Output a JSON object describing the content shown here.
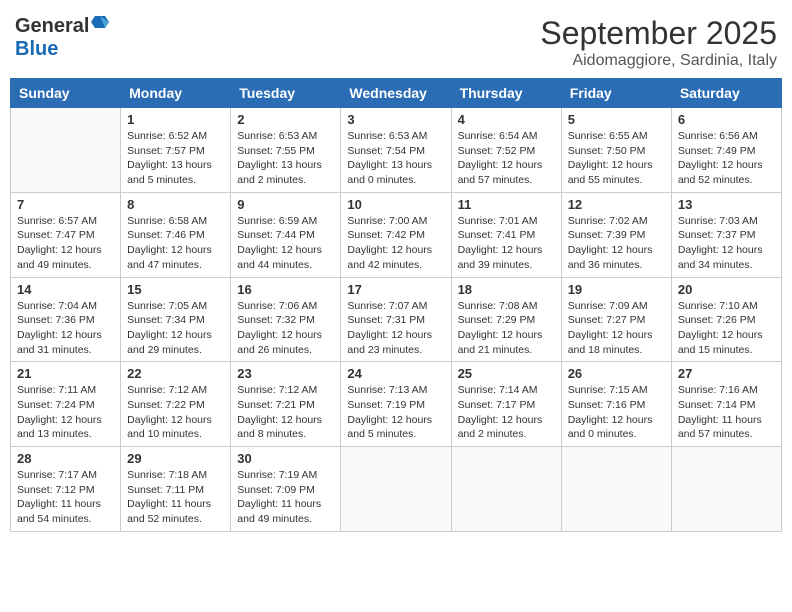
{
  "header": {
    "logo_general": "General",
    "logo_blue": "Blue",
    "title": "September 2025",
    "location": "Aidomaggiore, Sardinia, Italy"
  },
  "columns": [
    "Sunday",
    "Monday",
    "Tuesday",
    "Wednesday",
    "Thursday",
    "Friday",
    "Saturday"
  ],
  "weeks": [
    [
      {
        "day": "",
        "info": ""
      },
      {
        "day": "1",
        "info": "Sunrise: 6:52 AM\nSunset: 7:57 PM\nDaylight: 13 hours\nand 5 minutes."
      },
      {
        "day": "2",
        "info": "Sunrise: 6:53 AM\nSunset: 7:55 PM\nDaylight: 13 hours\nand 2 minutes."
      },
      {
        "day": "3",
        "info": "Sunrise: 6:53 AM\nSunset: 7:54 PM\nDaylight: 13 hours\nand 0 minutes."
      },
      {
        "day": "4",
        "info": "Sunrise: 6:54 AM\nSunset: 7:52 PM\nDaylight: 12 hours\nand 57 minutes."
      },
      {
        "day": "5",
        "info": "Sunrise: 6:55 AM\nSunset: 7:50 PM\nDaylight: 12 hours\nand 55 minutes."
      },
      {
        "day": "6",
        "info": "Sunrise: 6:56 AM\nSunset: 7:49 PM\nDaylight: 12 hours\nand 52 minutes."
      }
    ],
    [
      {
        "day": "7",
        "info": "Sunrise: 6:57 AM\nSunset: 7:47 PM\nDaylight: 12 hours\nand 49 minutes."
      },
      {
        "day": "8",
        "info": "Sunrise: 6:58 AM\nSunset: 7:46 PM\nDaylight: 12 hours\nand 47 minutes."
      },
      {
        "day": "9",
        "info": "Sunrise: 6:59 AM\nSunset: 7:44 PM\nDaylight: 12 hours\nand 44 minutes."
      },
      {
        "day": "10",
        "info": "Sunrise: 7:00 AM\nSunset: 7:42 PM\nDaylight: 12 hours\nand 42 minutes."
      },
      {
        "day": "11",
        "info": "Sunrise: 7:01 AM\nSunset: 7:41 PM\nDaylight: 12 hours\nand 39 minutes."
      },
      {
        "day": "12",
        "info": "Sunrise: 7:02 AM\nSunset: 7:39 PM\nDaylight: 12 hours\nand 36 minutes."
      },
      {
        "day": "13",
        "info": "Sunrise: 7:03 AM\nSunset: 7:37 PM\nDaylight: 12 hours\nand 34 minutes."
      }
    ],
    [
      {
        "day": "14",
        "info": "Sunrise: 7:04 AM\nSunset: 7:36 PM\nDaylight: 12 hours\nand 31 minutes."
      },
      {
        "day": "15",
        "info": "Sunrise: 7:05 AM\nSunset: 7:34 PM\nDaylight: 12 hours\nand 29 minutes."
      },
      {
        "day": "16",
        "info": "Sunrise: 7:06 AM\nSunset: 7:32 PM\nDaylight: 12 hours\nand 26 minutes."
      },
      {
        "day": "17",
        "info": "Sunrise: 7:07 AM\nSunset: 7:31 PM\nDaylight: 12 hours\nand 23 minutes."
      },
      {
        "day": "18",
        "info": "Sunrise: 7:08 AM\nSunset: 7:29 PM\nDaylight: 12 hours\nand 21 minutes."
      },
      {
        "day": "19",
        "info": "Sunrise: 7:09 AM\nSunset: 7:27 PM\nDaylight: 12 hours\nand 18 minutes."
      },
      {
        "day": "20",
        "info": "Sunrise: 7:10 AM\nSunset: 7:26 PM\nDaylight: 12 hours\nand 15 minutes."
      }
    ],
    [
      {
        "day": "21",
        "info": "Sunrise: 7:11 AM\nSunset: 7:24 PM\nDaylight: 12 hours\nand 13 minutes."
      },
      {
        "day": "22",
        "info": "Sunrise: 7:12 AM\nSunset: 7:22 PM\nDaylight: 12 hours\nand 10 minutes."
      },
      {
        "day": "23",
        "info": "Sunrise: 7:12 AM\nSunset: 7:21 PM\nDaylight: 12 hours\nand 8 minutes."
      },
      {
        "day": "24",
        "info": "Sunrise: 7:13 AM\nSunset: 7:19 PM\nDaylight: 12 hours\nand 5 minutes."
      },
      {
        "day": "25",
        "info": "Sunrise: 7:14 AM\nSunset: 7:17 PM\nDaylight: 12 hours\nand 2 minutes."
      },
      {
        "day": "26",
        "info": "Sunrise: 7:15 AM\nSunset: 7:16 PM\nDaylight: 12 hours\nand 0 minutes."
      },
      {
        "day": "27",
        "info": "Sunrise: 7:16 AM\nSunset: 7:14 PM\nDaylight: 11 hours\nand 57 minutes."
      }
    ],
    [
      {
        "day": "28",
        "info": "Sunrise: 7:17 AM\nSunset: 7:12 PM\nDaylight: 11 hours\nand 54 minutes."
      },
      {
        "day": "29",
        "info": "Sunrise: 7:18 AM\nSunset: 7:11 PM\nDaylight: 11 hours\nand 52 minutes."
      },
      {
        "day": "30",
        "info": "Sunrise: 7:19 AM\nSunset: 7:09 PM\nDaylight: 11 hours\nand 49 minutes."
      },
      {
        "day": "",
        "info": ""
      },
      {
        "day": "",
        "info": ""
      },
      {
        "day": "",
        "info": ""
      },
      {
        "day": "",
        "info": ""
      }
    ]
  ]
}
